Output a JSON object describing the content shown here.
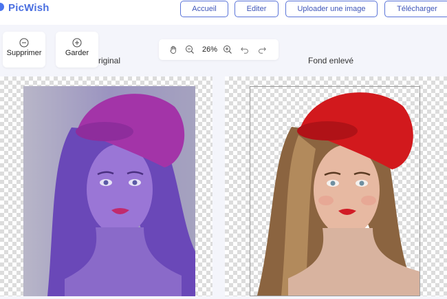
{
  "brand": {
    "name": "PicWish"
  },
  "nav": {
    "accueil": "Accueil",
    "editer": "Editer",
    "uploader": "Uploader une image",
    "telecharger": "Télécharger"
  },
  "tools": {
    "remove_label": "Supprimer",
    "keep_label": "Garder"
  },
  "zoom": {
    "value": "26%"
  },
  "panels": {
    "original_label": "riginal",
    "result_label": "Fond enlevé"
  },
  "colors": {
    "brand": "#4a6fe0",
    "button_border": "#5a74d8",
    "background": "#f4f5fb"
  },
  "icons": {
    "remove": "minus-circle-icon",
    "keep": "plus-circle-icon",
    "hand": "hand-icon",
    "zoom_out": "zoom-out-icon",
    "zoom_in": "zoom-in-icon",
    "undo": "undo-icon",
    "redo": "redo-icon"
  }
}
